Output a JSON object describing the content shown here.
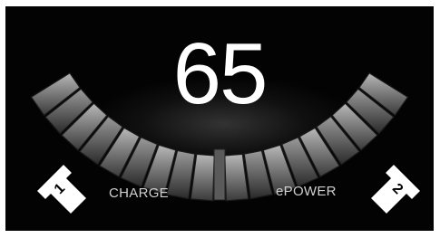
{
  "cluster": {
    "speed": "65",
    "charge_label": "CHARGE",
    "epower_label": "ePOWER"
  },
  "callouts": [
    {
      "number": "1",
      "icon": "arrow-callout-icon"
    },
    {
      "number": "2",
      "icon": "arrow-callout-icon"
    }
  ],
  "colors": {
    "background": "#030303",
    "text": "#ffffff",
    "segment": "#8a8a8a",
    "callout": "#ffffff"
  }
}
